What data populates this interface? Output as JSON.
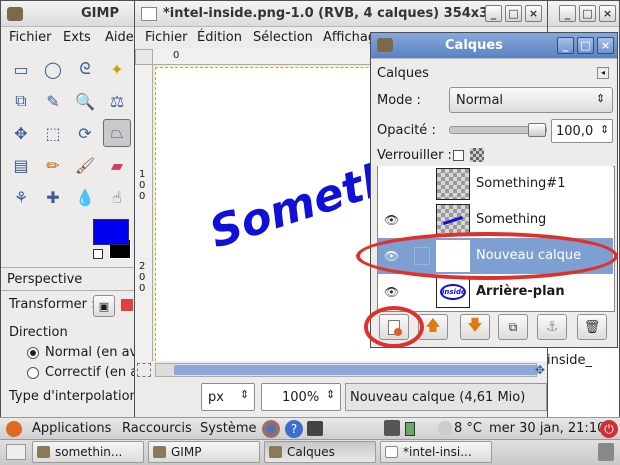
{
  "toolbox": {
    "title": "GIMP",
    "menus": [
      "Fichier",
      "Exts",
      "Aide"
    ],
    "options_title": "Perspective",
    "transformer_label": "Transformer :",
    "direction_label": "Direction",
    "direction_options": [
      "Normal (en av",
      "Correctif (en a"
    ],
    "interp_label": "Type d'interpolation",
    "fg_color": "#0000ee",
    "bg_color": "#000000"
  },
  "image_window": {
    "title": "*intel-inside.png-1.0 (RVB, 4 calques) 354x3",
    "menus": [
      "Fichier",
      "Édition",
      "Sélection",
      "Affichag"
    ],
    "canvas_text": "Somethin",
    "unit": "px",
    "zoom": "100%",
    "status": "Nouveau calque (4,61 Mio)",
    "ruler_v_top": [
      "1",
      "0",
      "0"
    ],
    "ruler_v_bottom": [
      "2",
      "0",
      "0"
    ],
    "ruler_h": [
      "0"
    ]
  },
  "layers_window": {
    "title": "Calques",
    "tab_label": "Calques",
    "mode_label": "Mode :",
    "mode_value": "Normal",
    "opacity_label": "Opacité :",
    "opacity_value": "100,0",
    "opacity_fraction": 1.0,
    "lock_label": "Verrouiller :",
    "layers": [
      {
        "name": "Something#1",
        "visible": false
      },
      {
        "name": "Something",
        "visible": true
      },
      {
        "name": "Nouveau calque",
        "visible": true,
        "selected": true
      },
      {
        "name": "Arrière-plan",
        "visible": true,
        "bold": true,
        "thumb_text": "inside"
      }
    ]
  },
  "background_window": {
    "title_fragment": "inside_",
    "title_fragment2": "e"
  },
  "panel": {
    "applications": "Applications",
    "places": "Raccourcis",
    "system": "Système",
    "weather": "8 °C",
    "clock": "mer 30 jan, 21:10"
  },
  "taskbar": {
    "items": [
      "somethin...",
      "GIMP",
      "Calques",
      "*intel-insi..."
    ]
  },
  "colors": {
    "accent": "#5b82c2",
    "selected_row": "#7e9fd2",
    "highlight_ring": "#e0302a",
    "canvas_text": "#1010d8"
  }
}
